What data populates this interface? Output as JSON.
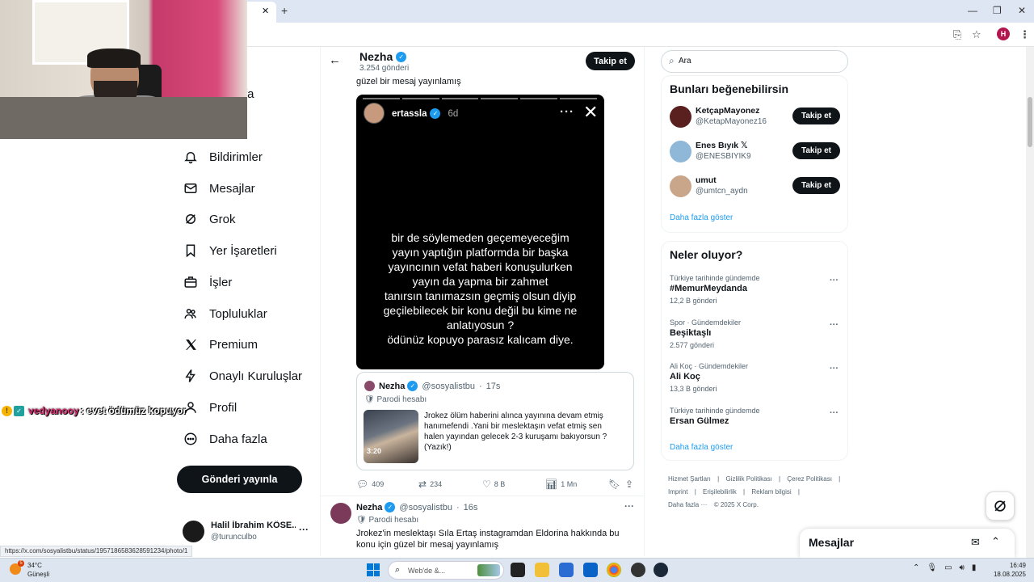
{
  "browser": {
    "tab_close": "✕",
    "new_tab": "+",
    "window_controls": [
      "—",
      "❐",
      "✕"
    ],
    "profile_initial": "H",
    "status_url": "https://x.com/sosyalistbu/status/1957186583628591234/photo/1"
  },
  "nav": {
    "items": [
      {
        "label": "Bildirimler",
        "icon": "bell-icon"
      },
      {
        "label": "Mesajlar",
        "icon": "mail-icon"
      },
      {
        "label": "Grok",
        "icon": "grok-icon"
      },
      {
        "label": "Yer İşaretleri",
        "icon": "bookmark-icon"
      },
      {
        "label": "İşler",
        "icon": "briefcase-icon"
      },
      {
        "label": "Topluluklar",
        "icon": "people-icon"
      },
      {
        "label": "Premium",
        "icon": "x-logo-icon"
      },
      {
        "label": "Onaylı Kuruluşlar",
        "icon": "lightning-icon"
      },
      {
        "label": "Profil",
        "icon": "person-icon"
      },
      {
        "label": "Daha fazla",
        "icon": "more-circle-icon"
      }
    ],
    "partial_item": "fa",
    "post_button": "Gönderi yayınla",
    "profile": {
      "name": "Halil İbrahim KÖSE...",
      "handle": "@turunculbo"
    }
  },
  "chat_overlay": {
    "badge1": "!",
    "badge2": "✓",
    "user": "vedyanooy",
    "message": " : evet ödümüz kopuyor"
  },
  "header": {
    "name": "Nezha",
    "post_count": "3.254 gönderi",
    "follow": "Takip et"
  },
  "tweet1": {
    "partial_text": "güzel bir mesaj yayınlamış",
    "story": {
      "user": "ertassla",
      "time": "6d",
      "lines": [
        "bir de söylemeden geçemeyeceğim",
        "yayın yaptığın platformda bir başka",
        "yayıncının vefat haberi konuşulurken",
        "yayın da yapma bir zahmet",
        "tanırsın tanımazsın geçmiş olsun diyip",
        "geçilebilecek bir konu değil bu kime ne",
        "anlatıyosun ?",
        "ödünüz kopuyo parasız kalıcam diye."
      ]
    },
    "quote": {
      "name": "Nezha",
      "handle": "@sosyalistbu",
      "time": "17s",
      "parody": "Parodi hesabı",
      "duration": "3:20",
      "text": "Jrokez ölüm haberini alınca yayınına devam etmiş hanımefendi .Yani bir meslektaşın vefat etmiş sen halen yayından gelecek 2-3 kuruşamı bakıyorsun ? (Yazık!)"
    },
    "actions": {
      "replies": "409",
      "reposts": "234",
      "likes": "8 B",
      "views": "1 Mn"
    }
  },
  "tweet2": {
    "name": "Nezha",
    "handle": "@sosyalistbu",
    "time": "16s",
    "parody": "Parodi hesabı",
    "text": "Jrokez'in meslektaşı Sıla Ertaş instagramdan Eldorina hakkında bu konu için güzel bir mesaj yayınlamış"
  },
  "search": {
    "placeholder": "Ara"
  },
  "who_to_follow": {
    "title": "Bunları beğenebilirsin",
    "users": [
      {
        "name": "KetçapMayonez",
        "handle": "@KetapMayonez16",
        "button": "Takip et",
        "color": "#5a1f1f"
      },
      {
        "name": "Enes Bıyık 𝕏",
        "handle": "@ENESBIYIK9",
        "button": "Takip et",
        "color": "#8fb7d8"
      },
      {
        "name": "umut",
        "handle": "@umtcn_aydn",
        "button": "Takip et",
        "color": "#c9a58a"
      }
    ],
    "show_more": "Daha fazla göster"
  },
  "trends": {
    "title": "Neler oluyor?",
    "items": [
      {
        "category": "Türkiye tarihinde gündemde",
        "name": "#MemurMeydanda",
        "count": "12,2 B gönderi"
      },
      {
        "category": "Spor · Gündemdekiler",
        "name": "Beşiktaşlı",
        "count": "2.577 gönderi"
      },
      {
        "category": "Ali Koç · Gündemdekiler",
        "name": "Ali Koç",
        "count": "13,3 B gönderi"
      },
      {
        "category": "Türkiye tarihinde gündemde",
        "name": "Ersan Gülmez",
        "count": ""
      }
    ],
    "show_more": "Daha fazla göster"
  },
  "footer": {
    "links": [
      "Hizmet Şartları",
      "|",
      "Gizlilik Politikası",
      "|",
      "Çerez Politikası",
      "|",
      "Imprint",
      "|",
      "Erişilebilirlik",
      "|",
      "Reklam bilgisi",
      "|",
      "Daha fazla ···",
      "© 2025 X Corp."
    ]
  },
  "messages_drawer": {
    "title": "Mesajlar"
  },
  "taskbar": {
    "temp": "34°C",
    "condition": "Güneşli",
    "weather_badge": "5",
    "search_placeholder": "Web'de &...",
    "time": "16:49",
    "date": "18.08.2025"
  },
  "colors": {
    "accent": "#1d9bf0",
    "text": "#0f1419",
    "muted": "#536471"
  }
}
